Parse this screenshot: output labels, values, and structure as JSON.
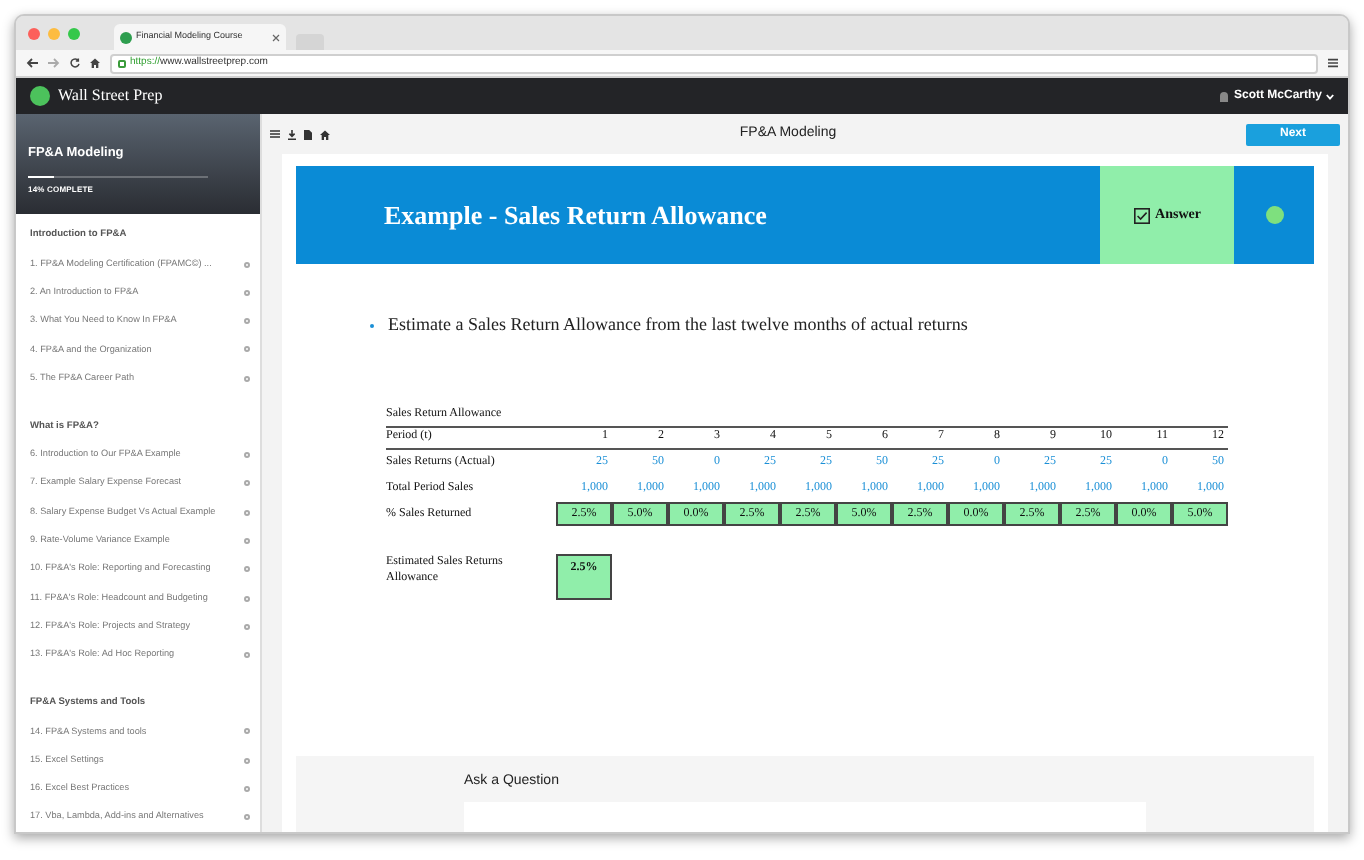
{
  "browser": {
    "tab_title": "Financial Modeling Course",
    "url_scheme": "https://",
    "url_host": "www.wallstreetprep.com"
  },
  "site_nav": {
    "brand": "Wall Street Prep",
    "user": "Scott McCarthy"
  },
  "sidebar": {
    "course_title": "FP&A Modeling",
    "progress": {
      "level": 0.14,
      "label": "14% COMPLETE"
    },
    "sections": [
      {
        "title": "Introduction to FP&A",
        "items": [
          "1. FP&A Modeling Certification (FPAMC©) ...",
          "2. An Introduction to FP&A",
          "3. What You Need to Know In FP&A",
          "4. FP&A and the Organization",
          "5. The FP&A Career Path"
        ]
      },
      {
        "title": "What is FP&A?",
        "items": [
          "6. Introduction to Our FP&A Example",
          "7. Example Salary Expense Forecast",
          "8. Salary Expense Budget Vs Actual Example",
          "9. Rate-Volume Variance Example",
          "10. FP&A's Role: Reporting and Forecasting",
          "11. FP&A's Role: Headcount and Budgeting",
          "12. FP&A's Role: Projects and Strategy",
          "13. FP&A's Role: Ad Hoc Reporting"
        ]
      },
      {
        "title": "FP&A Systems and Tools",
        "items": [
          "14. FP&A Systems and tools",
          "15. Excel Settings",
          "16. Excel Best Practices",
          "17. Vba, Lambda, Add-ins and Alternatives"
        ]
      }
    ]
  },
  "toolbar": {
    "title": "FP&A Modeling",
    "next_button": "Next"
  },
  "lesson": {
    "title": "Example - Sales Return Allowance",
    "answer": {
      "label": "Answer",
      "checked": true
    },
    "bullets": [
      "Estimate a Sales Return Allowance from the last twelve months of actual returns"
    ],
    "table": {
      "title": "Sales Return Allowance",
      "header": [
        "Period (t)",
        "1",
        "2",
        "3",
        "4",
        "5",
        "6",
        "7",
        "8",
        "9",
        "10",
        "11",
        "12"
      ],
      "rows": [
        {
          "label": "Sales Returns (Actual)",
          "kind": "input",
          "values": [
            "25",
            "50",
            "0",
            "25",
            "25",
            "50",
            "25",
            "0",
            "25",
            "25",
            "0",
            "50"
          ]
        },
        {
          "label": "Total Period Sales",
          "kind": "input",
          "values": [
            "1,000",
            "1,000",
            "1,000",
            "1,000",
            "1,000",
            "1,000",
            "1,000",
            "1,000",
            "1,000",
            "1,000",
            "1,000",
            "1,000"
          ]
        },
        {
          "label": "% Sales Returned",
          "kind": "output",
          "values": [
            "2.5%",
            "5.0%",
            "0.0%",
            "2.5%",
            "2.5%",
            "5.0%",
            "2.5%",
            "0.0%",
            "2.5%",
            "2.5%",
            "0.0%",
            "5.0%"
          ]
        }
      ],
      "estimate": {
        "label": "Estimated Sales Returns Allowance",
        "value": "2.5%"
      }
    }
  },
  "ask": {
    "title": "Ask a Question"
  }
}
